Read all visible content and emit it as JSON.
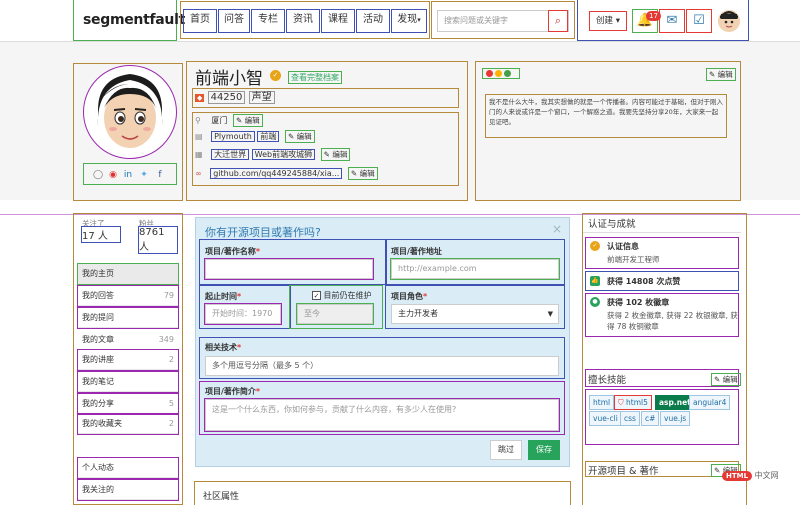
{
  "header": {
    "logo": "segmentfault",
    "nav": [
      "首页",
      "问答",
      "专栏",
      "资讯",
      "课程",
      "活动",
      "发现"
    ],
    "search_placeholder": "搜索问题或关键字",
    "create_label": "创建",
    "notification_count": "17"
  },
  "profile": {
    "name": "前端小智",
    "verify_link": "查看完整档案",
    "reputation": "44250",
    "reputation_label": "声望",
    "city": "厦门",
    "company": "Plymouth",
    "position": "前端",
    "school": "大迁世界",
    "major": "Web前端攻城狮",
    "site": "github.com/qq449245884/xia...",
    "edit_label": "编辑",
    "bio": "我不是什么大牛，我其实想做的就是一个传播者。内容可能过于基础，但对于刚入门的人来说或许是一个窗口，一个解惑之道。我要先坚持分享20年，大家来一起见证吧。"
  },
  "stats": {
    "following_label": "关注了",
    "following": "17 人",
    "followers_label": "粉丝",
    "followers": "8761 人"
  },
  "sidebar": [
    {
      "label": "我的主页",
      "count": ""
    },
    {
      "label": "我的回答",
      "count": "79"
    },
    {
      "label": "我的提问",
      "count": ""
    },
    {
      "label": "我的文章",
      "count": "349"
    },
    {
      "label": "我的讲座",
      "count": "2"
    },
    {
      "label": "我的笔记",
      "count": ""
    },
    {
      "label": "我的分享",
      "count": "5"
    },
    {
      "label": "我的收藏夹",
      "count": "2"
    },
    {
      "label": "个人动态",
      "count": ""
    },
    {
      "label": "我关注的",
      "count": ""
    }
  ],
  "form": {
    "title": "你有开源项目或著作吗?",
    "name_label": "项目/著作名称",
    "url_label": "项目/著作地址",
    "url_placeholder": "http://example.com",
    "start_label": "起止时间",
    "start_placeholder": "开始时间：1970",
    "ongoing_label": "目前仍在维护",
    "end_placeholder": "至今",
    "role_label": "项目角色",
    "role_value": "主力开发者",
    "tech_label": "相关技术",
    "tech_placeholder": "多个用逗号分隔（最多 5 个）",
    "desc_label": "项目/著作简介",
    "desc_placeholder": "这是一个什么东西，你如何参与，贡献了什么内容，有多少人在使用?",
    "skip_label": "跳过",
    "save_label": "保存",
    "required_mark": "*"
  },
  "community_label": "社区属性",
  "achievements": {
    "title": "认证与成就",
    "cert_title": "认证信息",
    "cert_desc": "前端开发工程师",
    "likes": "获得 14808 次点赞",
    "badges_title": "获得 102 枚徽章",
    "badges_desc": "获得 2 枚金徽章, 获得 22 枚银徽章, 获得 78 枚铜徽章"
  },
  "skills": {
    "title": "擅长技能",
    "tags": [
      "html",
      "html5",
      "asp.net",
      "angular4",
      "vue-cli",
      "css",
      "c#",
      "vue.js"
    ]
  },
  "projects_title": "开源项目 & 著作",
  "watermark": {
    "badge": "HTML",
    "text": "中文网"
  },
  "colors": {
    "accent": "#27a35b",
    "link": "#2f7ab0",
    "form_bg": "#daecf6",
    "band_bg": "#f5f5f5"
  }
}
